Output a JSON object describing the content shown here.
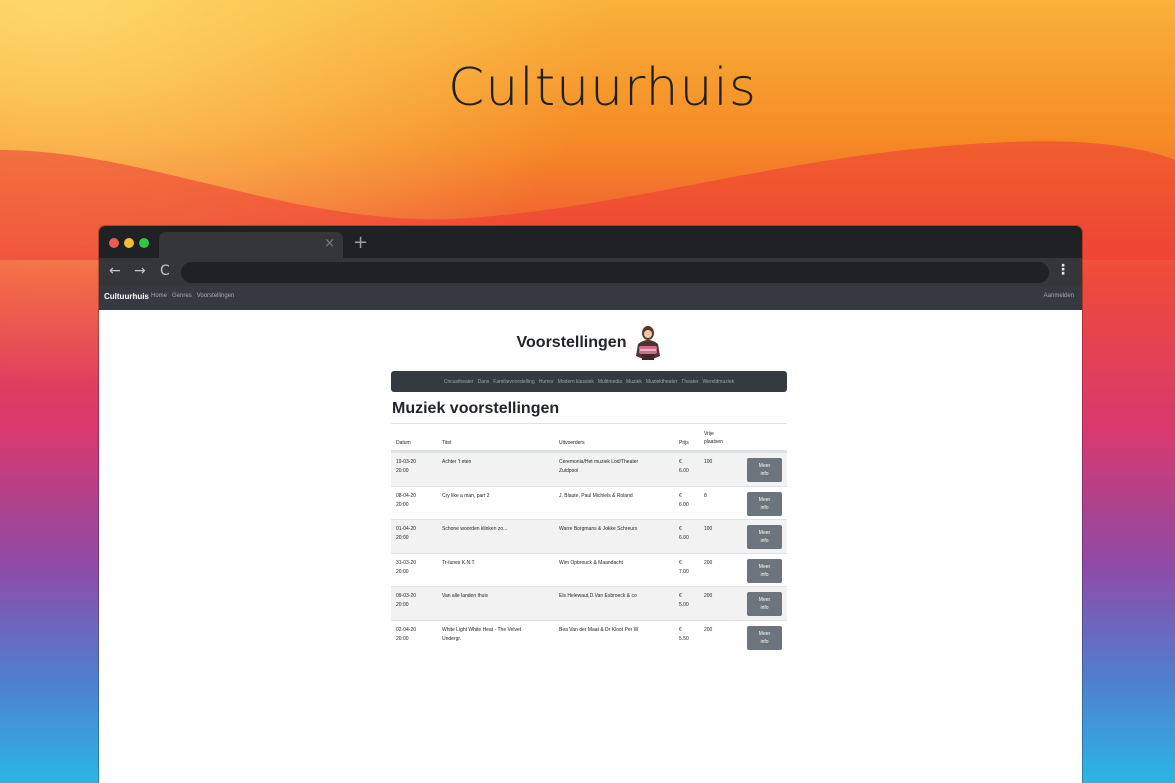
{
  "hero": {
    "title": "Cultuurhuis"
  },
  "browser": {
    "tab_close": "×",
    "new_tab": "+",
    "nav": {
      "back": "←",
      "forward": "→",
      "reload": "C"
    },
    "menu": "⋮"
  },
  "site_nav": {
    "brand": "Cultuurhuis",
    "links": [
      "Home",
      "Genres",
      "Voorstellingen"
    ],
    "login": "Aanmelden"
  },
  "page": {
    "heading": "Voorstellingen",
    "genres": [
      "Circustheater",
      "Dans",
      "Familievoorstelling",
      "Humor",
      "Modern klassiek",
      "Multimedia",
      "Muziek",
      "Muziektheater",
      "Theater",
      "Wereldmuziek"
    ],
    "section_title": "Muziek voorstellingen"
  },
  "table": {
    "headers": {
      "date": "Datum",
      "title": "Titel",
      "performers": "Uitvoerders",
      "price": "Prijs",
      "seats_line1": "Vrije",
      "seats_line2": "plaatsen"
    },
    "button_line1": "Meer",
    "button_line2": "info",
    "rows": [
      {
        "date_line1": "19-03-20",
        "date_line2": "20:00",
        "title_line1": "Achter 't eten",
        "title_line2": "",
        "performers_line1": "Ceremonia/Het muziek Lod/Theater",
        "performers_line2": "Zuidpool",
        "price_line1": "€",
        "price_line2": "6.00",
        "seats": "100"
      },
      {
        "date_line1": "08-04-20",
        "date_line2": "20:00",
        "title_line1": "Cry like a man, part 2",
        "title_line2": "",
        "performers_line1": "J. Blaute, Paul Michiels & Roland",
        "performers_line2": "",
        "price_line1": "€",
        "price_line2": "6.00",
        "seats": "8"
      },
      {
        "date_line1": "01-04-20",
        "date_line2": "20:00",
        "title_line1": "Schone woorden klinken zo...",
        "title_line2": "",
        "performers_line1": "Warre Borgmans & Jokke Schreurs",
        "performers_line2": "",
        "price_line1": "€",
        "price_line2": "6.00",
        "seats": "100"
      },
      {
        "date_line1": "31-03-20",
        "date_line2": "20:00",
        "title_line1": "Tr-tunes K.N.T.",
        "title_line2": "",
        "performers_line1": "Wim Opbrouck & Maandacht",
        "performers_line2": "",
        "price_line1": "€",
        "price_line2": "7.00",
        "seats": "200"
      },
      {
        "date_line1": "09-03-20",
        "date_line2": "20:00",
        "title_line1": "Van alle landen thuis",
        "title_line2": "",
        "performers_line1": "Els Helewaut,D.Van Esbroeck & co",
        "performers_line2": "",
        "price_line1": "€",
        "price_line2": "5.00",
        "seats": "200"
      },
      {
        "date_line1": "02-04-20",
        "date_line2": "20:00",
        "title_line1": "White Light White Heat - The Velvet",
        "title_line2": "Undergr.",
        "performers_line1": "Bea Van der Maat & Dr Kloot Per W",
        "performers_line2": "",
        "price_line1": "€",
        "price_line2": "5.50",
        "seats": "200"
      }
    ]
  },
  "colors": {
    "navbar": "#343a40",
    "button": "#6c757d",
    "row_stripe": "#f2f2f2",
    "chrome_dark": "#202124"
  }
}
